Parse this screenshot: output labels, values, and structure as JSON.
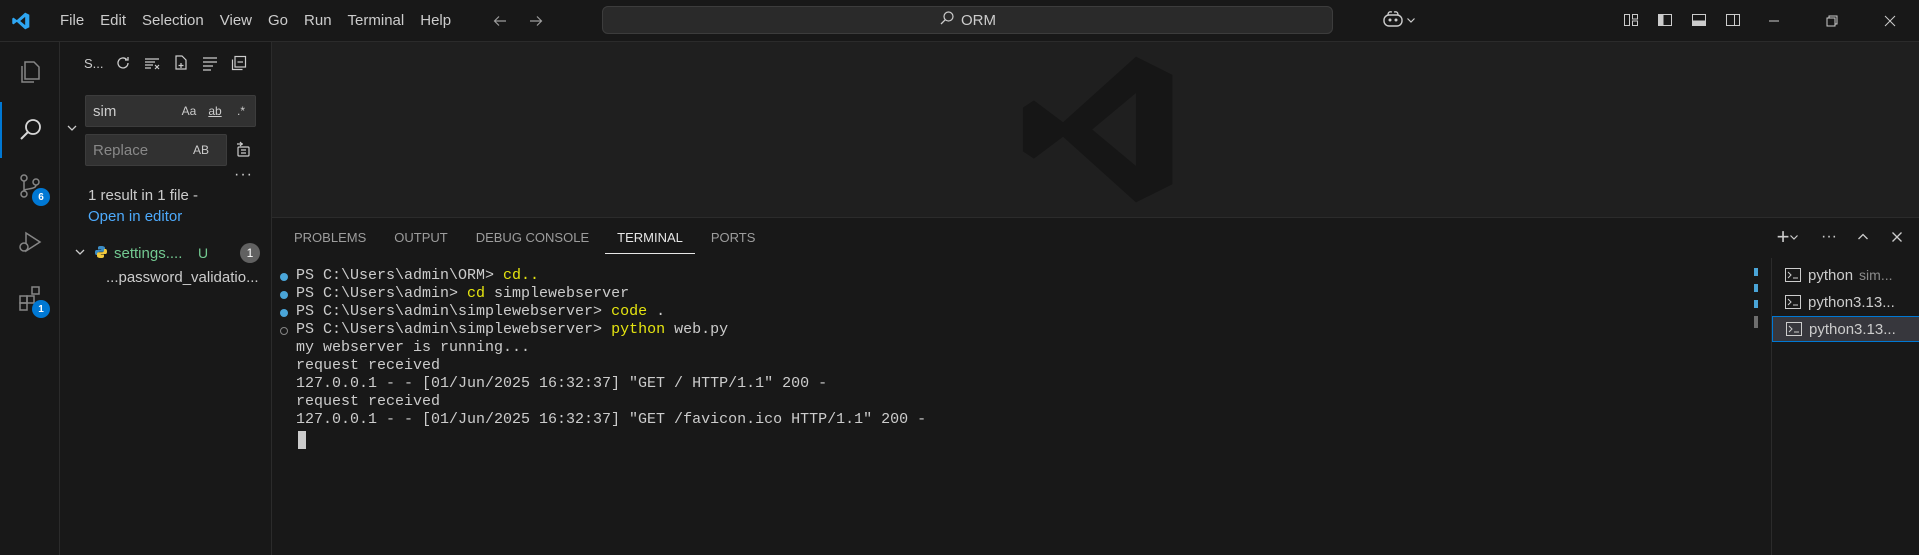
{
  "title_bar": {
    "menu": [
      "File",
      "Edit",
      "Selection",
      "View",
      "Go",
      "Run",
      "Terminal",
      "Help"
    ],
    "command_center": "ORM"
  },
  "activity_bar": {
    "source_control_badge": "6",
    "extensions_badge": "1"
  },
  "sidebar": {
    "title": "S...",
    "search_value": "sim",
    "search_options": [
      "Aa",
      "ab",
      ".*"
    ],
    "replace_placeholder": "Replace",
    "replace_option": "AB",
    "more": "···",
    "result_summary": "1 result in 1 file -",
    "open_in_editor": "Open in editor",
    "file": {
      "name": "settings....",
      "status": "U",
      "count": "1"
    },
    "match_text": "...password_validatio..."
  },
  "panel": {
    "tabs": [
      "PROBLEMS",
      "OUTPUT",
      "DEBUG CONSOLE",
      "TERMINAL",
      "PORTS"
    ],
    "active_tab": "TERMINAL",
    "actions": [
      "+",
      "···",
      "^",
      "×"
    ]
  },
  "terminal": {
    "lines": [
      {
        "prompt": "PS C:\\Users\\admin\\ORM> ",
        "command": "cd..",
        "args": ""
      },
      {
        "prompt": "PS C:\\Users\\admin> ",
        "command": "cd",
        "args": " simplewebserver"
      },
      {
        "prompt": "PS C:\\Users\\admin\\simplewebserver> ",
        "command": "code",
        "args": " ."
      },
      {
        "prompt": "PS C:\\Users\\admin\\simplewebserver> ",
        "command": "python",
        "args": " web.py"
      }
    ],
    "output": [
      "my webserver is running...",
      "request received",
      "127.0.0.1 - - [01/Jun/2025 16:32:37] \"GET / HTTP/1.1\" 200 -",
      "request received",
      "127.0.0.1 - - [01/Jun/2025 16:32:37] \"GET /favicon.ico HTTP/1.1\" 200 -"
    ]
  },
  "terminal_list": [
    {
      "name": "python",
      "sub": "sim..."
    },
    {
      "name": "python3.13...",
      "sub": ""
    },
    {
      "name": "python3.13...",
      "sub": ""
    }
  ],
  "colors": {
    "accent": "#0078d4",
    "command": "#e5e510",
    "link": "#4daafc",
    "untracked": "#73c991"
  }
}
